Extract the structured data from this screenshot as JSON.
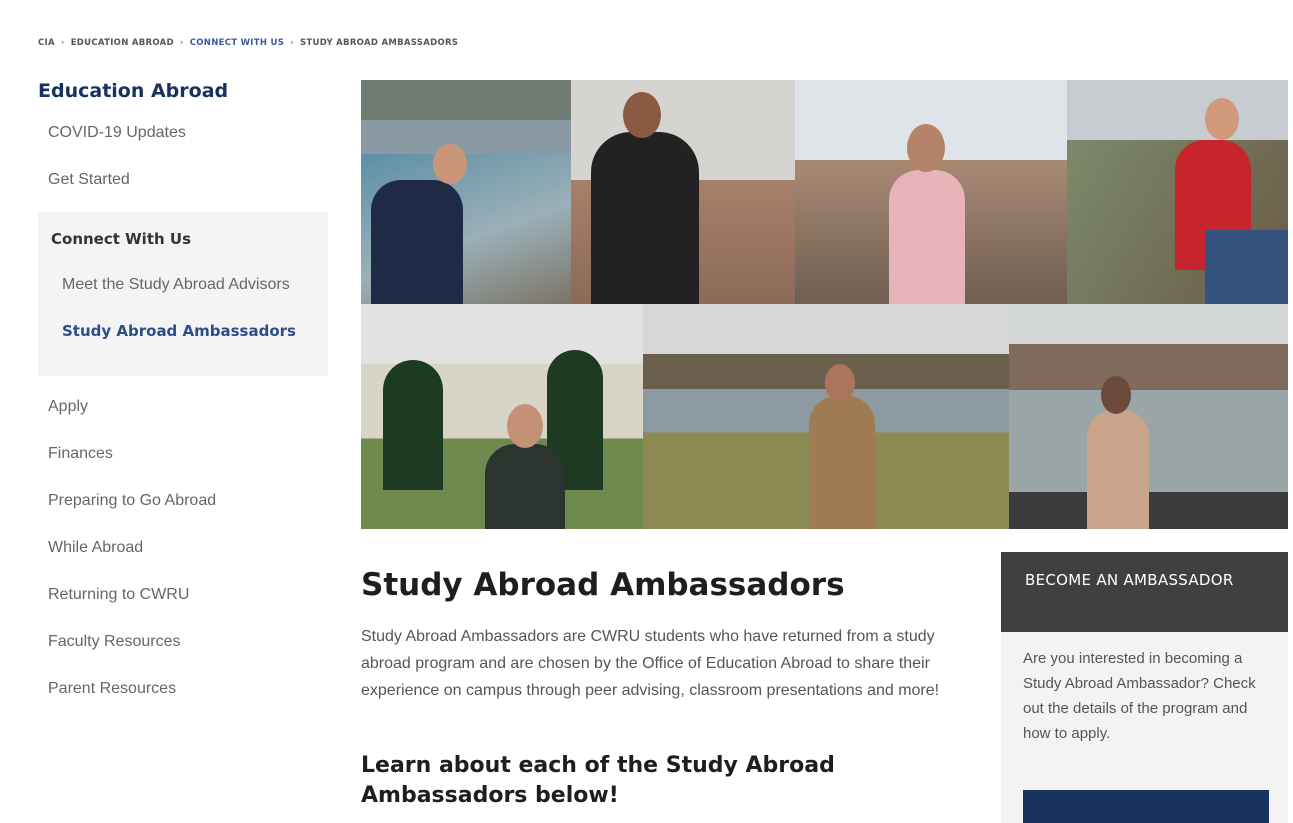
{
  "breadcrumb": [
    "CIA",
    "EDUCATION ABROAD",
    "CONNECT WITH US",
    "STUDY ABROAD AMBASSADORS"
  ],
  "sidebar": {
    "heading": "Education Abroad",
    "items_top": [
      "COVID-19 Updates",
      "Get Started"
    ],
    "group": {
      "title": "Connect With Us",
      "subitems": [
        "Meet the Study Abroad Advisors",
        "Study Abroad Ambassadors"
      ]
    },
    "items_bottom": [
      "Apply",
      "Finances",
      "Preparing to Go Abroad",
      "While Abroad",
      "Returning to CWRU",
      "Faculty Resources",
      "Parent Resources"
    ]
  },
  "main": {
    "title": "Study Abroad Ambassadors",
    "intro": "Study Abroad Ambassadors are CWRU students who have returned from a study abroad program and are chosen by the Office of Education Abroad to share their experience on campus through peer advising, classroom presentations and more!",
    "subtitle": "Learn about each of the Study Abroad Ambassadors below!"
  },
  "callout": {
    "heading": "BECOME AN AMBASSADOR",
    "body": "Are you interested in becoming a Study Abroad Ambassador? Check out the details of the program and how to apply.",
    "button_label": ""
  },
  "colors": {
    "brand_navy": "#17325e",
    "active_link": "#2c4c8c",
    "callout_header": "#404040"
  }
}
